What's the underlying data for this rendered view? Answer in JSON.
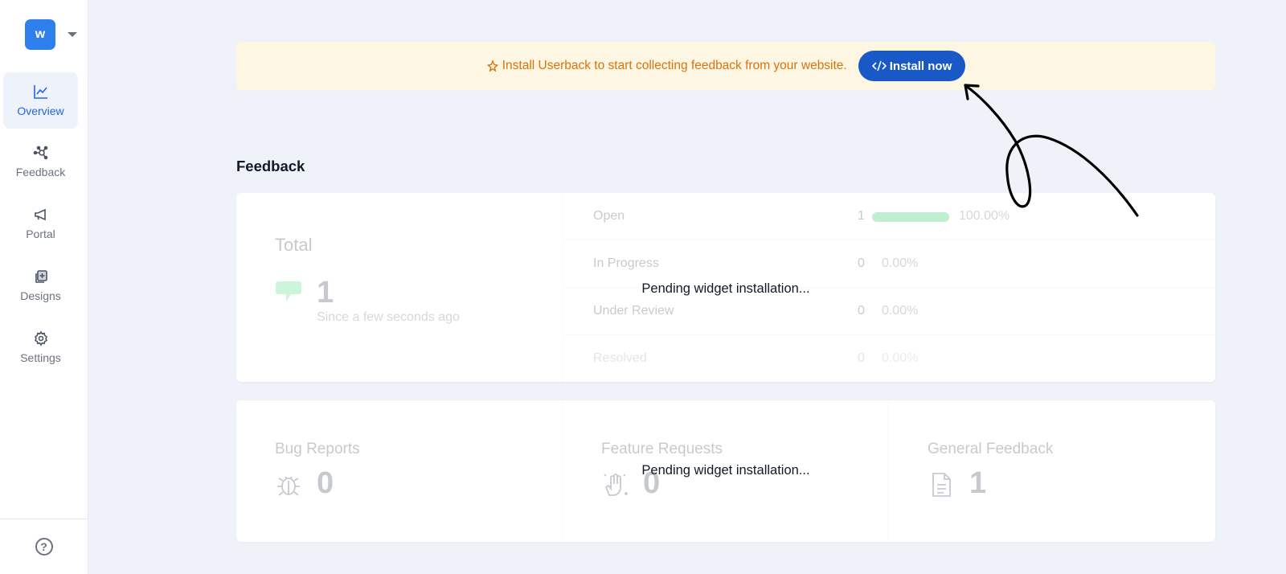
{
  "sidebar": {
    "workspace_initial": "w",
    "items": [
      {
        "label": "Overview",
        "icon": "chart-line-icon",
        "active": true
      },
      {
        "label": "Feedback",
        "icon": "nodes-icon",
        "active": false
      },
      {
        "label": "Portal",
        "icon": "megaphone-icon",
        "active": false
      },
      {
        "label": "Designs",
        "icon": "designs-icon",
        "active": false
      },
      {
        "label": "Settings",
        "icon": "gear-icon",
        "active": false
      }
    ],
    "help_icon": "?"
  },
  "banner": {
    "text": "Install Userback to start collecting feedback from your website.",
    "button_label": "Install now",
    "icon": "sparkle-icon"
  },
  "feedback": {
    "title": "Feedback",
    "total": {
      "label": "Total",
      "value": "1",
      "since": "Since a few seconds ago"
    },
    "statuses": [
      {
        "label": "Open",
        "count": "1",
        "percent": "100.00%",
        "fraction": 1.0
      },
      {
        "label": "In Progress",
        "count": "0",
        "percent": "0.00%",
        "fraction": 0
      },
      {
        "label": "Under Review",
        "count": "0",
        "percent": "0.00%",
        "fraction": 0
      },
      {
        "label": "Resolved",
        "count": "0",
        "percent": "0.00%",
        "fraction": 0
      }
    ],
    "pending_message": "Pending widget installation...",
    "categories": [
      {
        "label": "Bug Reports",
        "value": "0",
        "icon": "bug-icon"
      },
      {
        "label": "Feature Requests",
        "value": "0",
        "icon": "hand-sparkle-icon"
      },
      {
        "label": "General Feedback",
        "value": "1",
        "icon": "document-icon"
      }
    ]
  },
  "colors": {
    "accent": "#2f80ed",
    "install_button": "#1859c7",
    "banner_bg": "#fdf6e3",
    "banner_text": "#d9730d",
    "progress_green": "#22c55e"
  }
}
